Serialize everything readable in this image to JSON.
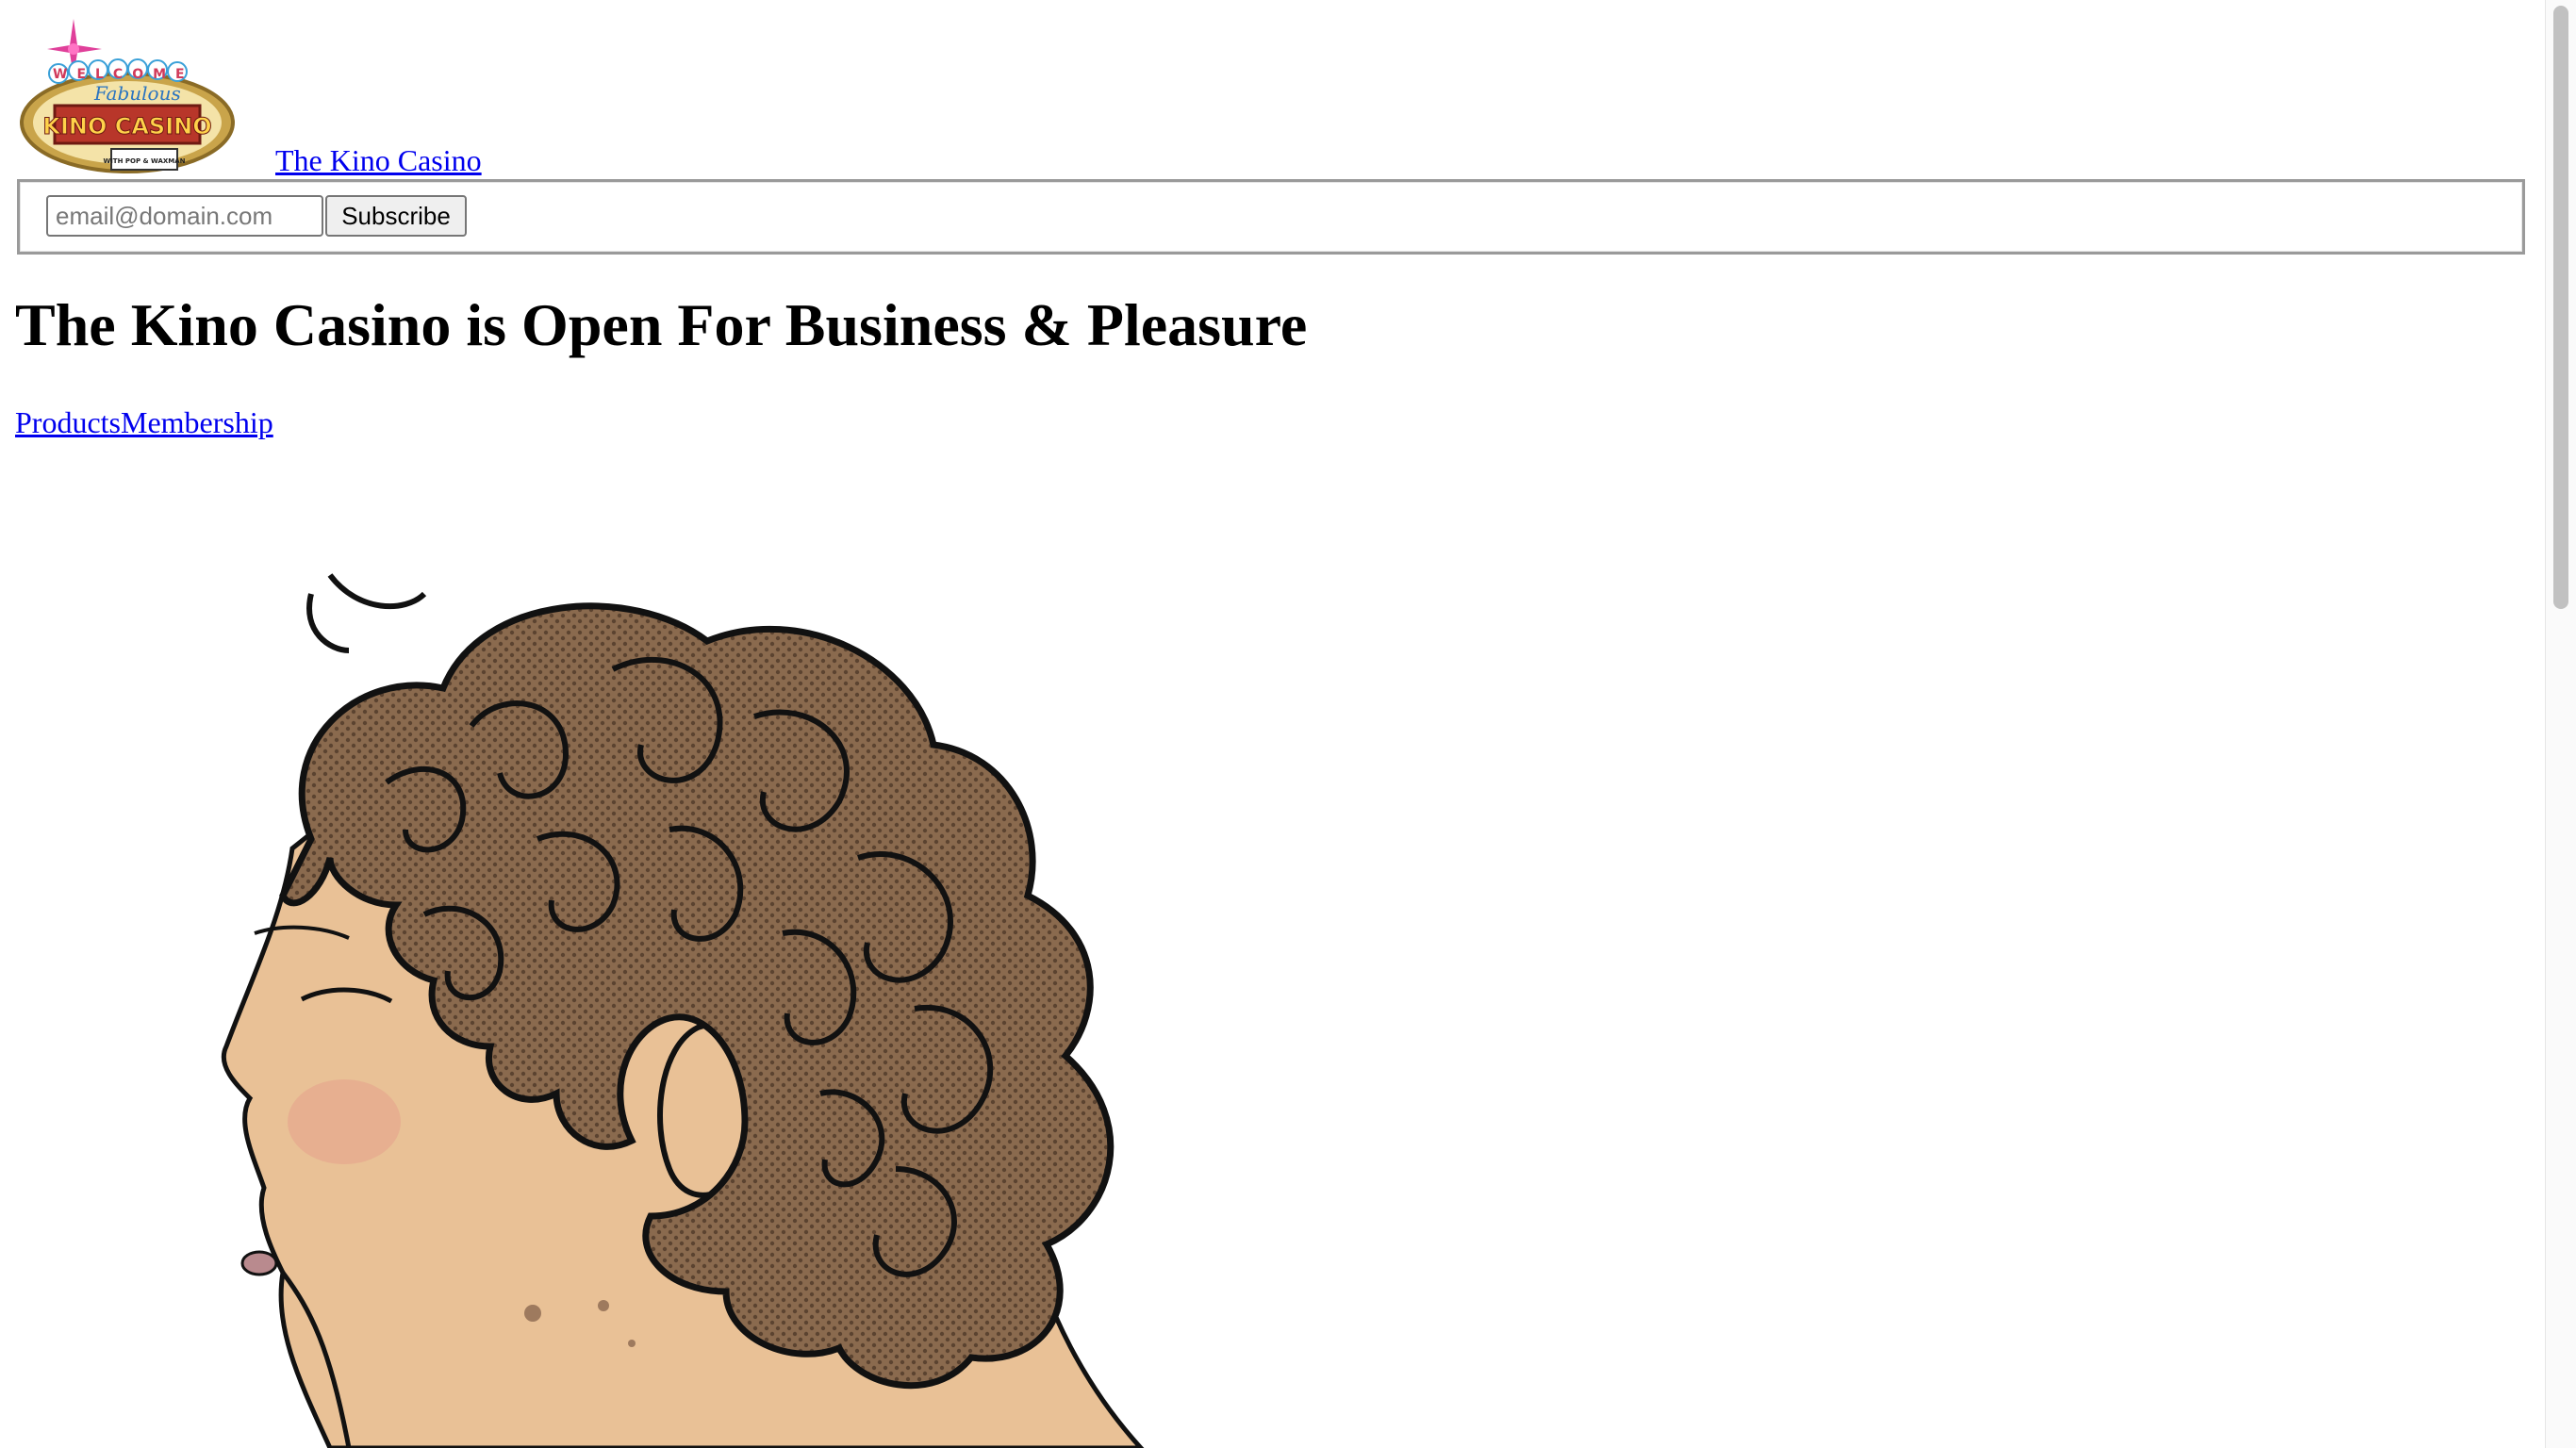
{
  "header": {
    "logo_alt": "Welcome to Fabulous Kino Casino",
    "logo_text": {
      "welcome": "WELCOME",
      "fabulous": "Fabulous",
      "name": "KINO CASINO",
      "tag": "WITH POP & WAXMAN"
    },
    "site_link": "The Kino Casino"
  },
  "subscribe": {
    "email_placeholder": "email@domain.com",
    "button_label": "Subscribe"
  },
  "main": {
    "headline": "The Kino Casino is Open For Business & Pleasure"
  },
  "nav": {
    "items": [
      "Products",
      "Membership"
    ]
  },
  "illustration": {
    "alt": "Cartoon profile of a person with curly brown hair"
  },
  "colors": {
    "link": "#0000ee",
    "skin": "#e9c196",
    "hair": "#7a6048"
  }
}
